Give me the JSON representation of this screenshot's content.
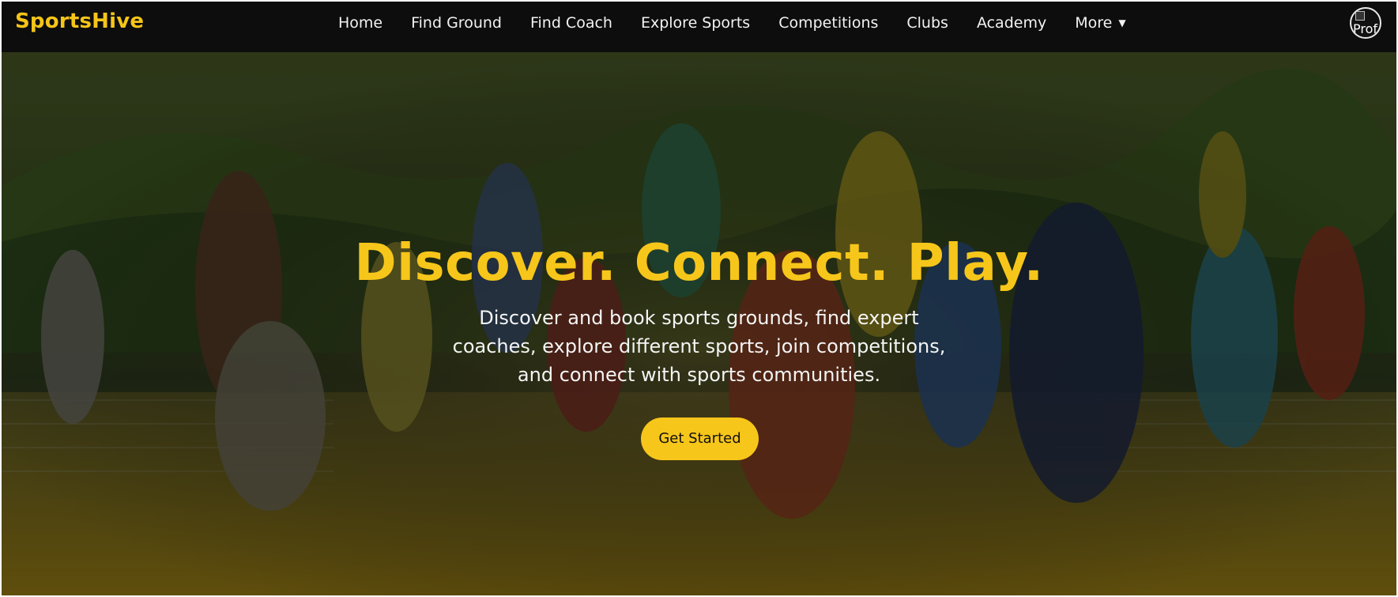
{
  "navbar": {
    "brand": "SportsHive",
    "links": [
      "Home",
      "Find Ground",
      "Find Coach",
      "Explore Sports",
      "Competitions",
      "Clubs",
      "Academy"
    ],
    "more_label": "More",
    "more_icon": "caret-down-icon",
    "avatar_alt": "Prof"
  },
  "hero": {
    "title": "Discover. Connect. Play.",
    "subtitle": "Discover and book sports grounds, find expert coaches, explore different sports, join competitions, and connect with sports communities.",
    "cta_label": "Get Started"
  },
  "colors": {
    "accent": "#f7c61a",
    "nav_bg": "#0d0d0d",
    "text_light": "#f4f4f4"
  }
}
